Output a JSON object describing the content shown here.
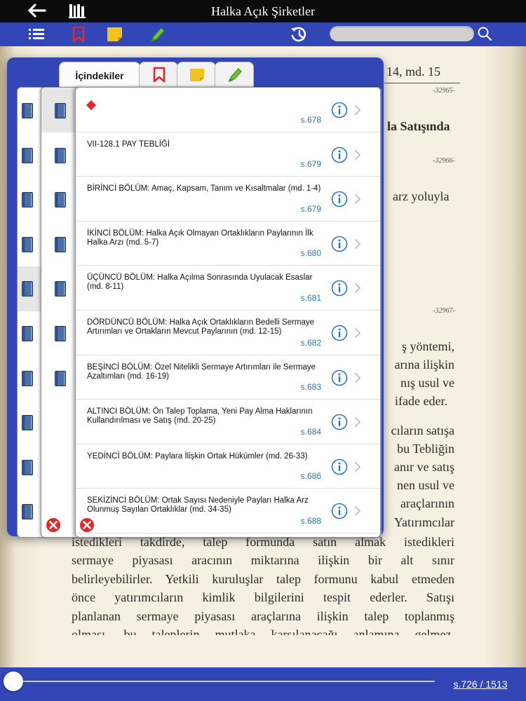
{
  "header": {
    "title": "Halka Açık Şirketler"
  },
  "toolbar": {
    "search": {
      "value": "",
      "placeholder": ""
    }
  },
  "page": {
    "heading_right": ". 14, md. 15",
    "num1": "-32965-",
    "heading2": "la Satışında",
    "num2": "-32966-",
    "line_arz": "arz yoluyla",
    "num3": "-32967-",
    "fragments": [
      "ş yöntemi,",
      "arına ilişkin",
      "nış usul ve",
      "ifade eder.",
      "cıların satışa",
      "bu Tebliğin",
      "anır ve satış",
      "nen usul ve",
      "araçlarının",
      "Yatırımcılar"
    ],
    "paragraph": [
      "istedikleri takdirde, talep formunda satın almak istedikleri",
      "sermaye piyasası aracının miktarına ilişkin bir alt sınır",
      "belirleyebilirler. Yetkili kuruluşlar talep formunu kabul etmeden",
      "önce yatırımcıların kimlik bilgilerini tespit ederler. Satışı",
      "planlanan sermaye piyasası araçlarına ilişkin talep toplanmış",
      "olması, bu taleplerin mutlaka karşılanacağı anlamına gelmez."
    ]
  },
  "toc": {
    "tab_label": "İçindekiler",
    "rows": [
      {
        "title": "",
        "page": "s.678"
      },
      {
        "title": "VII-128.1 PAY TEBLİĞİ",
        "page": "s.679"
      },
      {
        "title": "BİRİNCİ BÖLÜM: Amaç, Kapsam, Tanım ve Kısaltmalar (md. 1-4)",
        "page": "s.679"
      },
      {
        "title": "İKİNCİ BÖLÜM: Halka Açık Olmayan Ortaklıkların Paylarının İlk Halka Arzı (md. 5-7)",
        "page": "s.680"
      },
      {
        "title": "ÜÇÜNCÜ BÖLÜM: Halka Açılma Sonrasında Uyulacak Esaslar (md. 8-11)",
        "page": "s.681"
      },
      {
        "title": "DÖRDÜNCÜ BÖLÜM: Halka Açık Ortaklıkların Bedelli Sermaye Artırımları ve Ortakların Mevcut Paylarının  (md. 12-15)",
        "page": "s.682"
      },
      {
        "title": "BEŞİNCİ BÖLÜM: Özel Nitelikli Sermaye Artırımları ile Sermaye Azaltımları (md. 16-19)",
        "page": "s.683"
      },
      {
        "title": "ALTINCI BÖLÜM: Ön Talep Toplama, Yeni Pay Alma Haklarının Kullandırılması ve Satış (md. 20-25)",
        "page": "s.684"
      },
      {
        "title": "YEDİNCİ BÖLÜM: Paylara İlişkin Ortak Hükümler (md. 26-33)",
        "page": "s.686"
      },
      {
        "title": "SEKİZİNCİ BÖLÜM: Ortak Sayısı Nedeniyle Payları Halka Arz Olunmuş Sayılan Ortaklıklar (md. 34-35)",
        "page": "s.688"
      }
    ]
  },
  "footer": {
    "page_indicator": "s.726 / 1513",
    "progress": 0.0
  },
  "colors": {
    "toolbar": "#3346b5",
    "link": "#2b73cc",
    "bookmark": "#e02828",
    "note": "#f2c320",
    "highlighter": "#6cc43c"
  },
  "icons": [
    "back-icon",
    "library-icon",
    "menu-icon",
    "bookmark-icon",
    "note-icon",
    "highlighter-icon",
    "history-icon",
    "search-icon",
    "book-icon",
    "info-icon",
    "chevron-right-icon",
    "close-icon",
    "diamond-icon"
  ]
}
